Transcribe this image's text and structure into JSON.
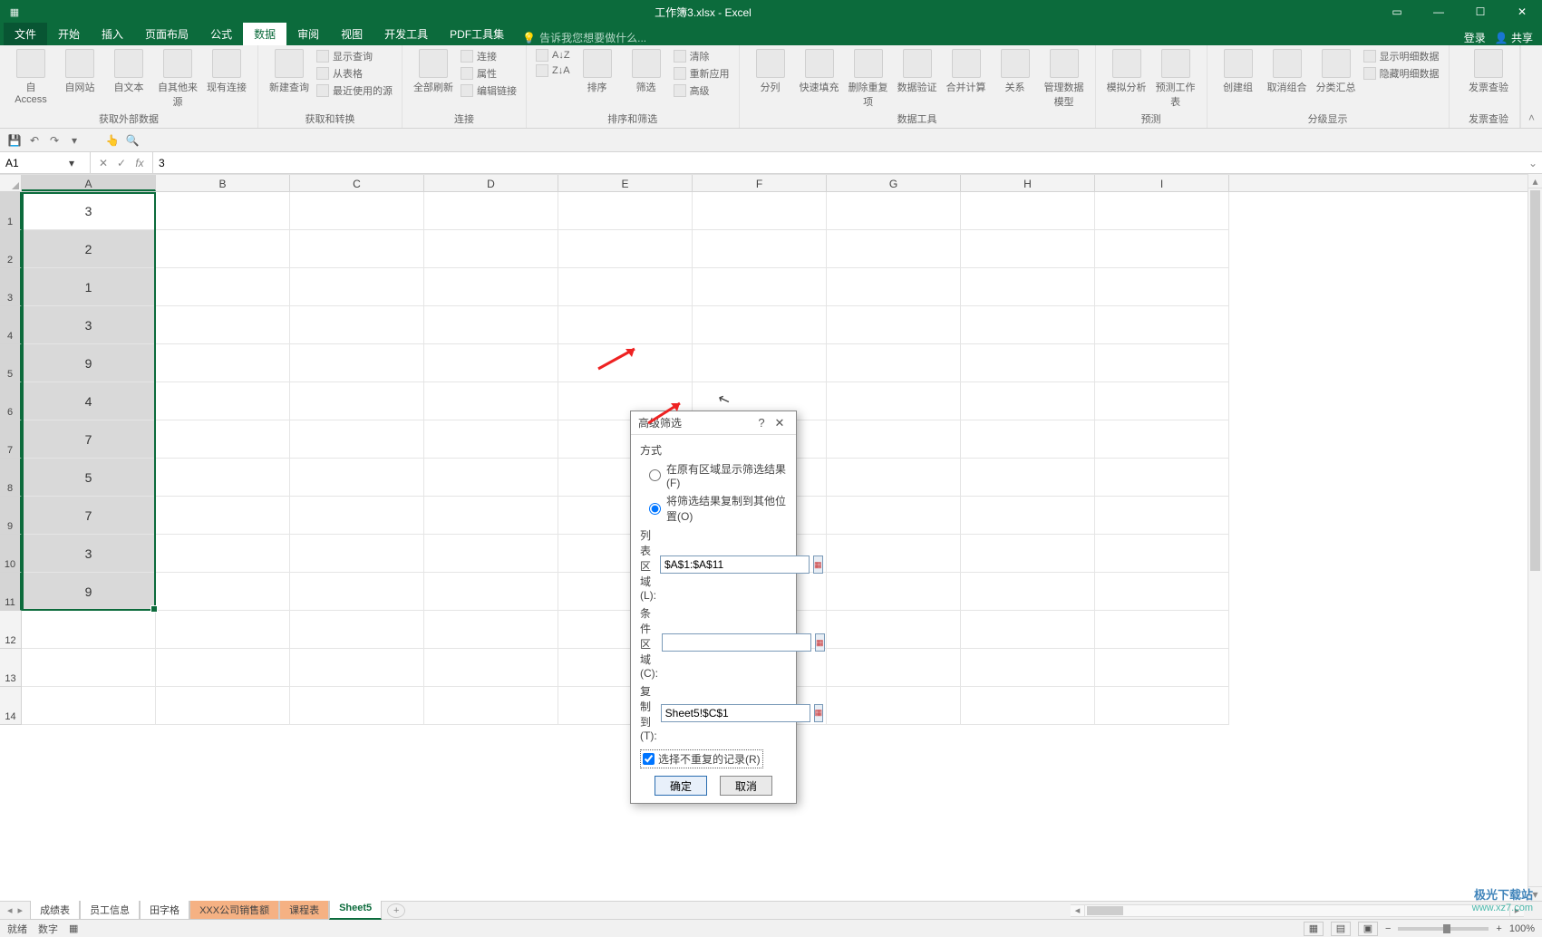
{
  "titlebar": {
    "title": "工作簿3.xlsx - Excel"
  },
  "window_controls": {
    "help": "?",
    "min": "—",
    "max": "☐",
    "close": "✕",
    "ribmin": "▭"
  },
  "tabs": {
    "file": "文件",
    "list": [
      "开始",
      "插入",
      "页面布局",
      "公式",
      "数据",
      "审阅",
      "视图",
      "开发工具",
      "PDF工具集"
    ],
    "active_index": 4,
    "tell_me": "告诉我您想要做什么...",
    "login": "登录",
    "share": "共享"
  },
  "ribbon": {
    "groups": [
      {
        "name": "获取外部数据",
        "big": [
          "自 Access",
          "自网站",
          "自文本",
          "自其他来源",
          "现有连接"
        ]
      },
      {
        "name": "获取和转换",
        "big": [
          "新建查询"
        ],
        "small": [
          "显示查询",
          "从表格",
          "最近使用的源"
        ]
      },
      {
        "name": "连接",
        "big": [
          "全部刷新"
        ],
        "small": [
          "连接",
          "属性",
          "编辑链接"
        ]
      },
      {
        "name": "排序和筛选",
        "big": [
          "排序",
          "筛选"
        ],
        "small": [
          "清除",
          "重新应用",
          "高级"
        ],
        "pre": [
          "A↓Z",
          "Z↓A"
        ]
      },
      {
        "name": "数据工具",
        "big": [
          "分列",
          "快速填充",
          "删除重复项",
          "数据验证",
          "合并计算",
          "关系",
          "管理数据模型"
        ]
      },
      {
        "name": "预测",
        "big": [
          "模拟分析",
          "预测工作表"
        ]
      },
      {
        "name": "分级显示",
        "big": [
          "创建组",
          "取消组合",
          "分类汇总"
        ],
        "small": [
          "显示明细数据",
          "隐藏明细数据"
        ]
      },
      {
        "name": "发票查验",
        "big": [
          "发票查验"
        ]
      }
    ]
  },
  "qat": {
    "icons": [
      "save",
      "undo",
      "redo",
      "touch",
      "search-doc"
    ]
  },
  "formula_bar": {
    "cell_ref": "A1",
    "fx": "fx",
    "value": "3",
    "cancel": "✕",
    "enter": "✓"
  },
  "columns": [
    "A",
    "B",
    "C",
    "D",
    "E",
    "F",
    "G",
    "H",
    "I"
  ],
  "rows": [
    1,
    2,
    3,
    4,
    5,
    6,
    7,
    8,
    9,
    10,
    11,
    12,
    13,
    14
  ],
  "cells_A": [
    "3",
    "2",
    "1",
    "3",
    "9",
    "4",
    "7",
    "5",
    "7",
    "3",
    "9"
  ],
  "selection": {
    "range": "A1:A11",
    "active": "A1"
  },
  "dialog": {
    "title": "高级筛选",
    "help": "?",
    "close": "✕",
    "group": "方式",
    "radio1": "在原有区域显示筛选结果(F)",
    "radio2": "将筛选结果复制到其他位置(O)",
    "list_label": "列表区域(L):",
    "list_value": "$A$1:$A$11",
    "cond_label": "条件区域(C):",
    "cond_value": "",
    "copy_label": "复制到(T):",
    "copy_value": "Sheet5!$C$1",
    "unique": "选择不重复的记录(R)",
    "ok": "确定",
    "cancel": "取消"
  },
  "sheets": {
    "tabs": [
      "成绩表",
      "员工信息",
      "田字格",
      "XXX公司销售额",
      "课程表",
      "Sheet5"
    ],
    "active": "Sheet5",
    "orange": [
      "XXX公司销售额",
      "课程表"
    ],
    "add": "+"
  },
  "status": {
    "ready": "就绪",
    "num": "数字",
    "rec": "▦",
    "zoom": "100%",
    "plus": "+",
    "minus": "−"
  },
  "watermark": {
    "l1": "极光下载站",
    "l2": "www.xz7.com"
  }
}
